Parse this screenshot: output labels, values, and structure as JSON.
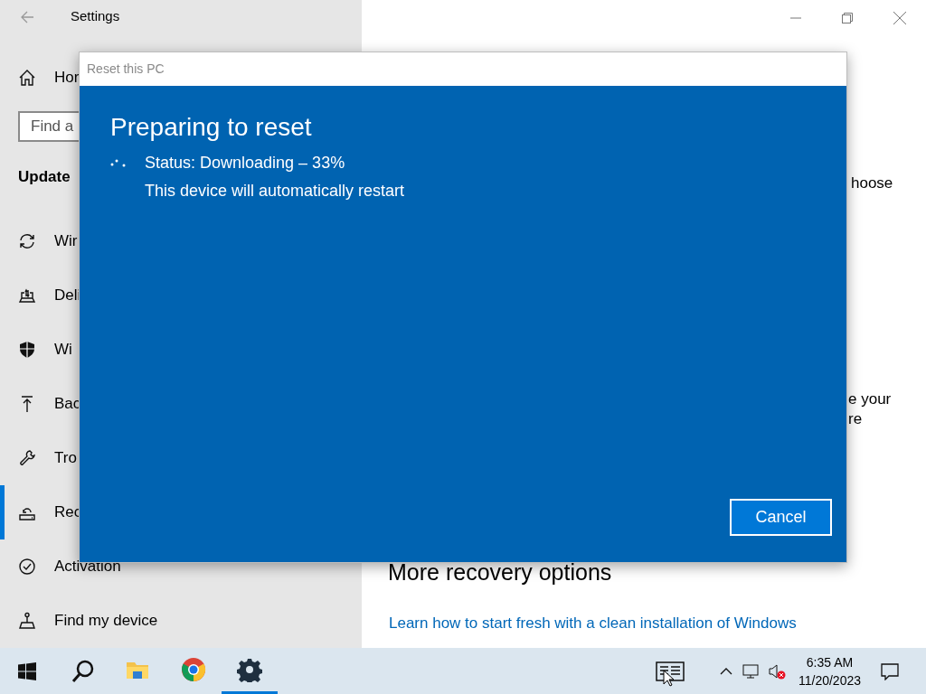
{
  "settings_window": {
    "title": "Settings",
    "home": "Hor",
    "search": {
      "placeholder": "Find a"
    },
    "section_heading": "Update",
    "nav_items": [
      {
        "label": "Wir",
        "selected": false
      },
      {
        "label": "Deli",
        "selected": false
      },
      {
        "label": "Wi",
        "selected": false
      },
      {
        "label": "Bac",
        "selected": false
      },
      {
        "label": "Tro",
        "selected": false
      },
      {
        "label": "Rec",
        "selected": true
      },
      {
        "label": "Activation",
        "selected": false
      },
      {
        "label": "Find my device",
        "selected": false
      }
    ],
    "content": {
      "text_1": "hoose",
      "text_2": "e your",
      "text_3": "re",
      "heading": "More recovery options",
      "link": "Learn how to start fresh with a clean installation of Windows"
    }
  },
  "dialog": {
    "title": "Reset this PC",
    "heading": "Preparing to reset",
    "status": "Status: Downloading – 33%",
    "note": "This device will automatically restart",
    "cancel": "Cancel"
  },
  "taskbar": {
    "apps": [
      {
        "selected": false
      },
      {
        "selected": false
      },
      {
        "selected": true
      }
    ],
    "time": "6:35 AM",
    "date": "11/20/2023"
  }
}
